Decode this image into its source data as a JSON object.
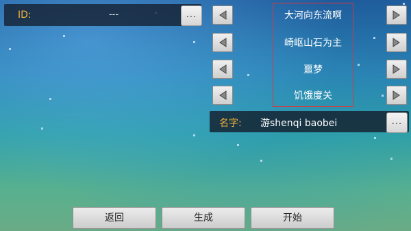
{
  "id_field": {
    "label": "ID:",
    "value": "---",
    "more_label": "..."
  },
  "options": [
    {
      "text": "大河向东流啊"
    },
    {
      "text": "崎岖山石为主"
    },
    {
      "text": "噩梦"
    },
    {
      "text": "饥饿度关"
    }
  ],
  "name_field": {
    "label": "名字:",
    "value": "游shenqi baobei",
    "more_label": "..."
  },
  "buttons": {
    "back": "返回",
    "generate": "生成",
    "start": "开始"
  },
  "colors": {
    "label_orange": "#f2b23a",
    "selection_border": "#d8383e"
  },
  "icons": {
    "prev": "triangle-left-icon",
    "next": "triangle-right-icon"
  }
}
